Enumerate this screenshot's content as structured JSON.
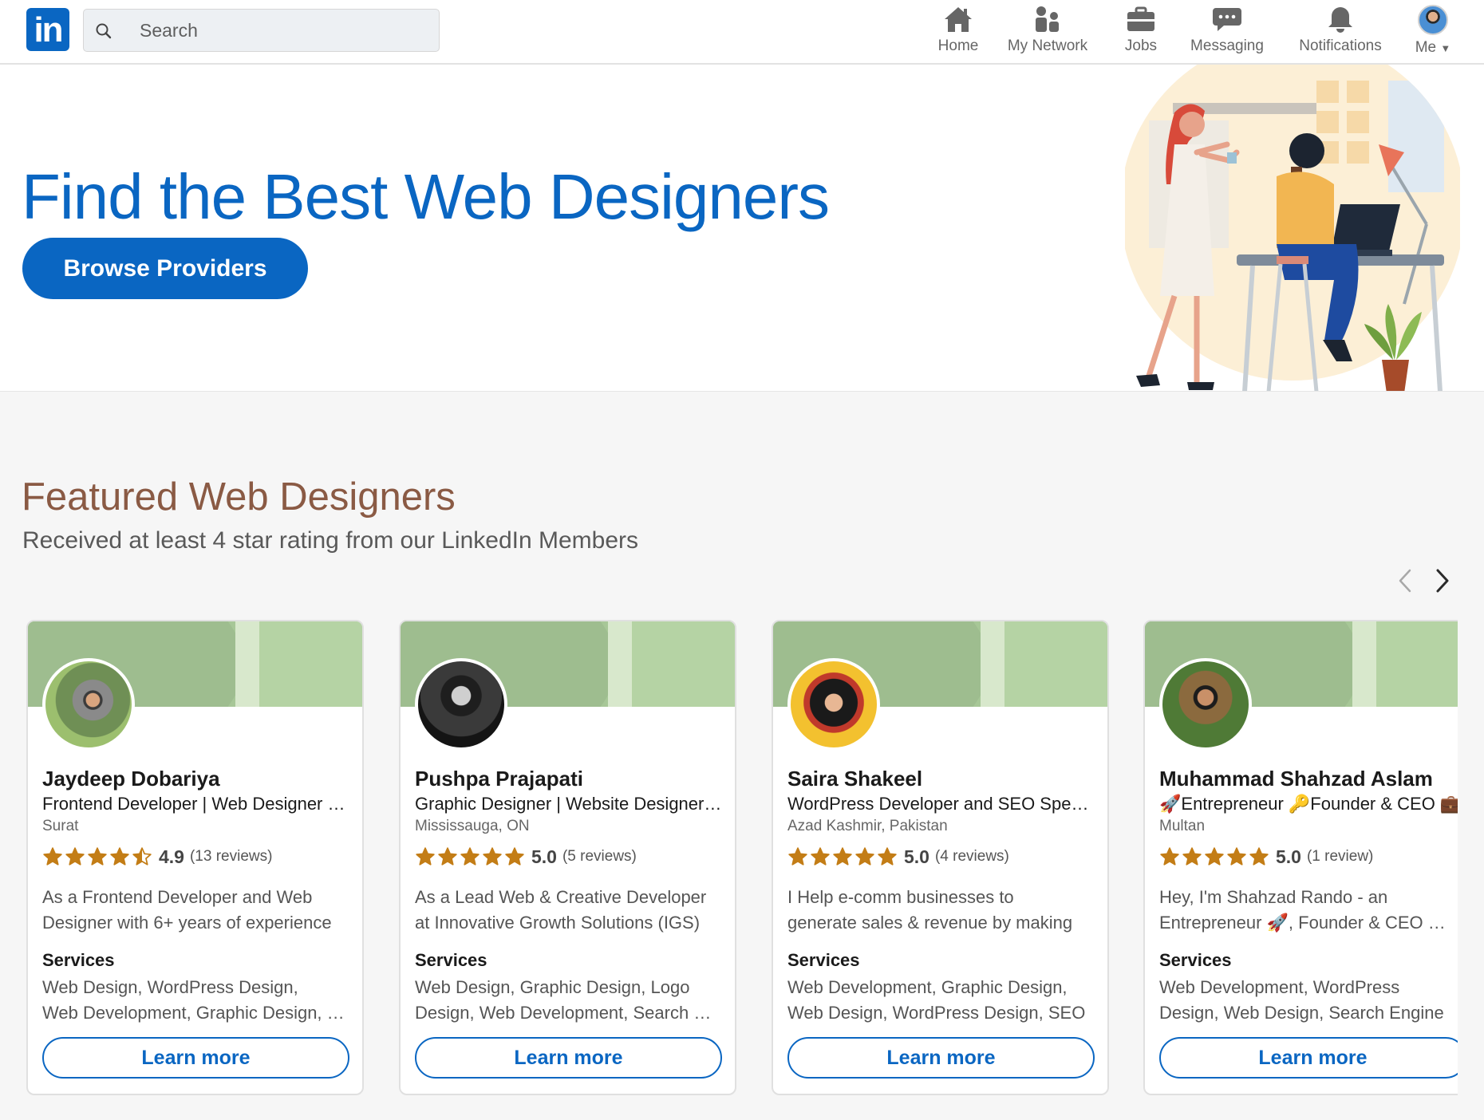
{
  "header": {
    "logo_text": "in",
    "search_placeholder": "Search",
    "nav": [
      {
        "label": "Home",
        "icon": "home-icon"
      },
      {
        "label": "My Network",
        "icon": "network-icon"
      },
      {
        "label": "Jobs",
        "icon": "briefcase-icon"
      },
      {
        "label": "Messaging",
        "icon": "chat-icon"
      },
      {
        "label": "Notifications",
        "icon": "bell-icon"
      },
      {
        "label": "Me",
        "icon": "profile-avatar"
      }
    ]
  },
  "hero": {
    "title": "Find the Best Web Designers",
    "button_label": "Browse Providers"
  },
  "featured": {
    "title": "Featured Web Designers",
    "subtitle": "Received at least 4 star rating from our LinkedIn Members",
    "prev_icon": "chevron-left-icon",
    "next_icon": "chevron-right-icon"
  },
  "colors": {
    "brand": "#0a66c2",
    "heading_brown": "#8a5a44",
    "star": "#c37d16",
    "banner_green": "#a7c797"
  },
  "cards": [
    {
      "name": "Jaydeep Dobariya",
      "headline": "Frontend Developer | Web Designer | WordPress",
      "location": "Surat",
      "rating": 4.9,
      "score": "4.9",
      "reviews": "(13 reviews)",
      "about_line1": "As a Frontend Developer and Web",
      "about_line2": "Designer with 6+ years of experience",
      "services_label": "Services",
      "services_line1": "Web Design, WordPress Design,",
      "services_line2": "Web Development, Graphic Design, SEO",
      "button": "Learn more"
    },
    {
      "name": "Pushpa Prajapati",
      "headline": "Graphic Designer | Website Designer | Logo",
      "location": "Mississauga, ON",
      "rating": 5.0,
      "score": "5.0",
      "reviews": "(5 reviews)",
      "about_line1": "As a Lead Web & Creative Developer",
      "about_line2": "at Innovative Growth Solutions (IGS)",
      "services_label": "Services",
      "services_line1": "Web Design, Graphic Design, Logo",
      "services_line2": "Design, Web Development, Search Engine",
      "button": "Learn more"
    },
    {
      "name": "Saira Shakeel",
      "headline": "WordPress Developer and SEO Specialist",
      "location": "Azad Kashmir, Pakistan",
      "rating": 5.0,
      "score": "5.0",
      "reviews": "(4 reviews)",
      "about_line1": "I Help e-comm businesses to",
      "about_line2": "generate sales & revenue by making",
      "services_label": "Services",
      "services_line1": "Web Development, Graphic Design,",
      "services_line2": "Web Design, WordPress Design, SEO",
      "button": "Learn more"
    },
    {
      "name": "Muhammad Shahzad Aslam",
      "headline": "🚀Entrepreneur 🔑Founder & CEO 💼",
      "location": "Multan",
      "rating": 5.0,
      "score": "5.0",
      "reviews": "(1 review)",
      "about_line1": "Hey, I'm Shahzad Rando - an",
      "about_line2": "Entrepreneur 🚀, Founder & CEO 🔑, Investor",
      "services_label": "Services",
      "services_line1": "Web Development, WordPress",
      "services_line2": "Design, Web Design, Search Engine",
      "button": "Learn more"
    }
  ]
}
